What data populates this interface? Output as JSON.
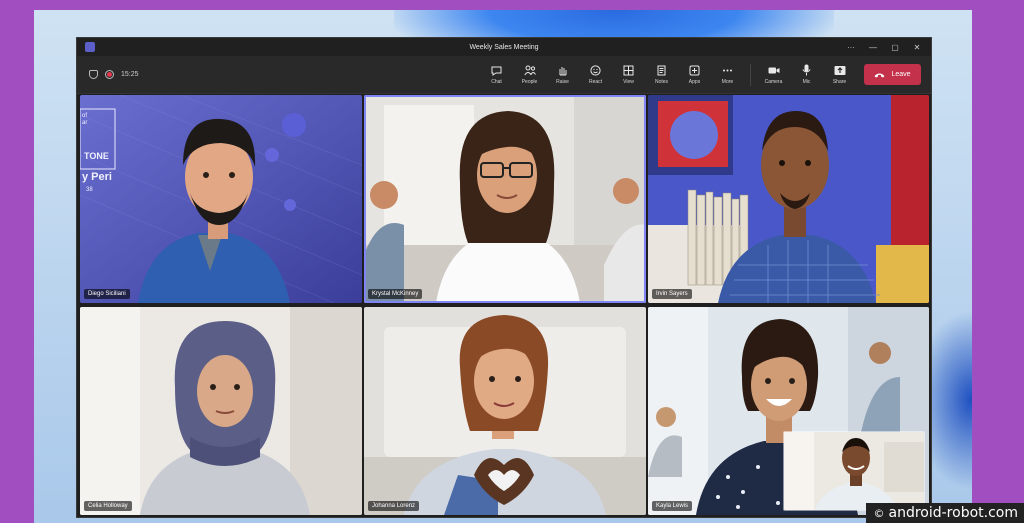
{
  "window": {
    "title": "Weekly Sales Meeting"
  },
  "window_controls": [
    "···",
    "—",
    "▢",
    "✕"
  ],
  "toolbar": {
    "timer": "15:25",
    "tools": [
      {
        "name": "chat",
        "label": "Chat",
        "icon": "chat-icon"
      },
      {
        "name": "people",
        "label": "People",
        "icon": "people-icon"
      },
      {
        "name": "raise",
        "label": "Raise",
        "icon": "hand-icon"
      },
      {
        "name": "react",
        "label": "React",
        "icon": "smile-icon"
      },
      {
        "name": "view",
        "label": "View",
        "icon": "grid-icon"
      },
      {
        "name": "notes",
        "label": "Notes",
        "icon": "notes-icon"
      },
      {
        "name": "apps",
        "label": "Apps",
        "icon": "plus-icon"
      },
      {
        "name": "more",
        "label": "More",
        "icon": "more-icon"
      }
    ],
    "devices": [
      {
        "name": "camera",
        "label": "Camera",
        "icon": "camera-icon"
      },
      {
        "name": "mic",
        "label": "Mic",
        "icon": "mic-icon"
      },
      {
        "name": "share",
        "label": "Share",
        "icon": "share-icon"
      }
    ],
    "leave_label": "Leave"
  },
  "participants": [
    {
      "name": "Diego Siciliani",
      "art": "Pantone poster: TONE, y Peri, 38, of, ar"
    },
    {
      "name": "Krystal McKinney",
      "active": true
    },
    {
      "name": "Irvin Sayers"
    },
    {
      "name": "Celia Holloway"
    },
    {
      "name": "Johanna Lorenz"
    },
    {
      "name": "Kayla Lewis"
    }
  ],
  "poster": {
    "line1": "of",
    "line2": "ar",
    "tone": "TONE",
    "peri": "y Peri",
    "num": "38"
  },
  "watermark": {
    "symbol": "©",
    "text": "android-robot.com"
  },
  "colors": {
    "leave": "#c4314b",
    "active_border": "#7f85f5",
    "accent": "#5b5fc7"
  }
}
